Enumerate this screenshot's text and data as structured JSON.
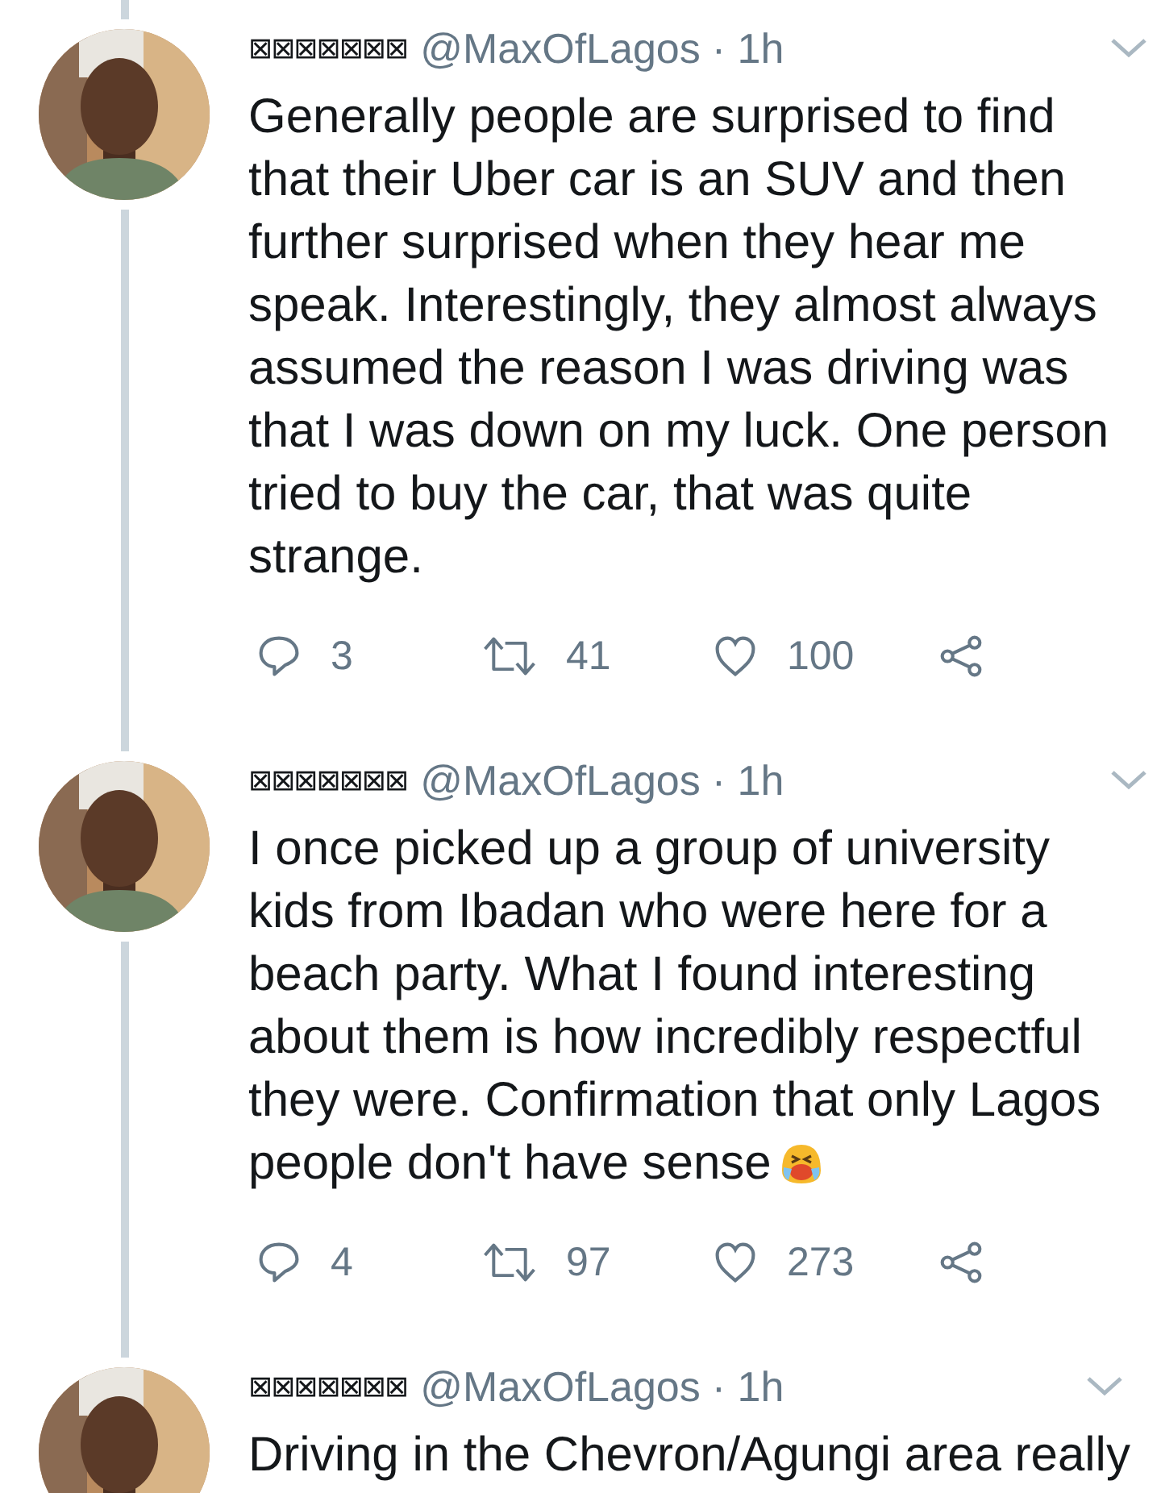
{
  "tweets": [
    {
      "display_name": "⊠⊠⊠⊠⊠⊠⊠",
      "handle": "@MaxOfLagos",
      "time": "· 1h",
      "text": "Generally people are surprised to find that their Uber car is an SUV and then further surprised when they hear me speak. Interestingly, they almost always assumed the reason I was driving was that I was down on my luck. One person tried to buy the car, that was quite strange.",
      "emoji": false,
      "replies": "3",
      "retweets": "41",
      "likes": "100"
    },
    {
      "display_name": "⊠⊠⊠⊠⊠⊠⊠",
      "handle": "@MaxOfLagos",
      "time": "· 1h",
      "text": "I once picked up a group of university kids from Ibadan who were here for a beach party. What I found interesting about them is how incredibly respectful they were. Confirmation that only Lagos people don't have sense",
      "emoji": true,
      "replies": "4",
      "retweets": "97",
      "likes": "273"
    },
    {
      "display_name": "⊠⊠⊠⊠⊠⊠⊠",
      "handle": "@MaxOfLagos",
      "time": "· 1h",
      "text": "Driving in the Chevron/Agungi area really",
      "emoji": false
    }
  ]
}
